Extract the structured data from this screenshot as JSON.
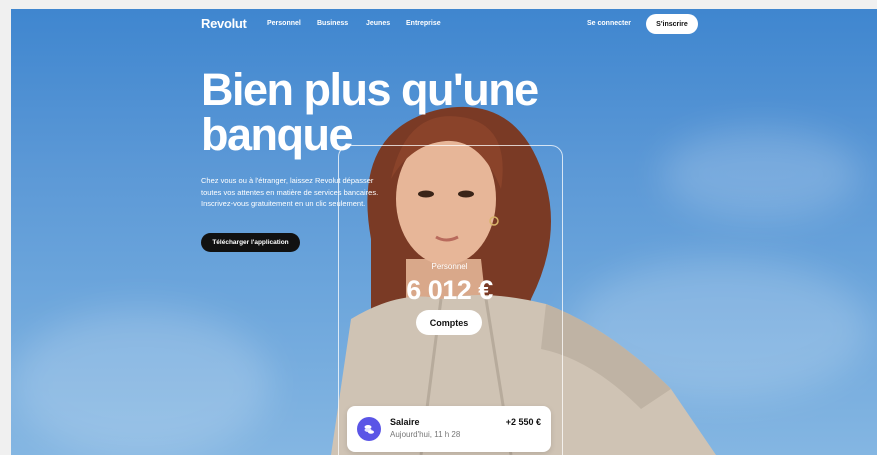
{
  "nav": {
    "logo": "Revolut",
    "links": [
      "Personnel",
      "Business",
      "Jeunes",
      "Entreprise"
    ],
    "login": "Se connecter",
    "signup": "S'inscrire"
  },
  "hero": {
    "title_line1": "Bien plus qu'une",
    "title_line2": "banque",
    "description": "Chez vous ou à l'étranger, laissez Revolut dépasser toutes vos attentes en matière de services bancaires. Inscrivez-vous gratuitement en un clic seulement.",
    "download_button": "Télécharger l'application"
  },
  "card": {
    "account_label": "Personnel",
    "balance": "6 012 €",
    "accounts_button": "Comptes"
  },
  "transaction": {
    "name": "Salaire",
    "time": "Aujourd'hui, 11 h 28",
    "amount": "+2 550 €",
    "icon": "stack-coins-icon"
  },
  "colors": {
    "sky_top": "#3f86cf",
    "sky_bottom": "#84b6e2",
    "transaction_icon": "#5a55e6",
    "dark_button": "#111111"
  }
}
